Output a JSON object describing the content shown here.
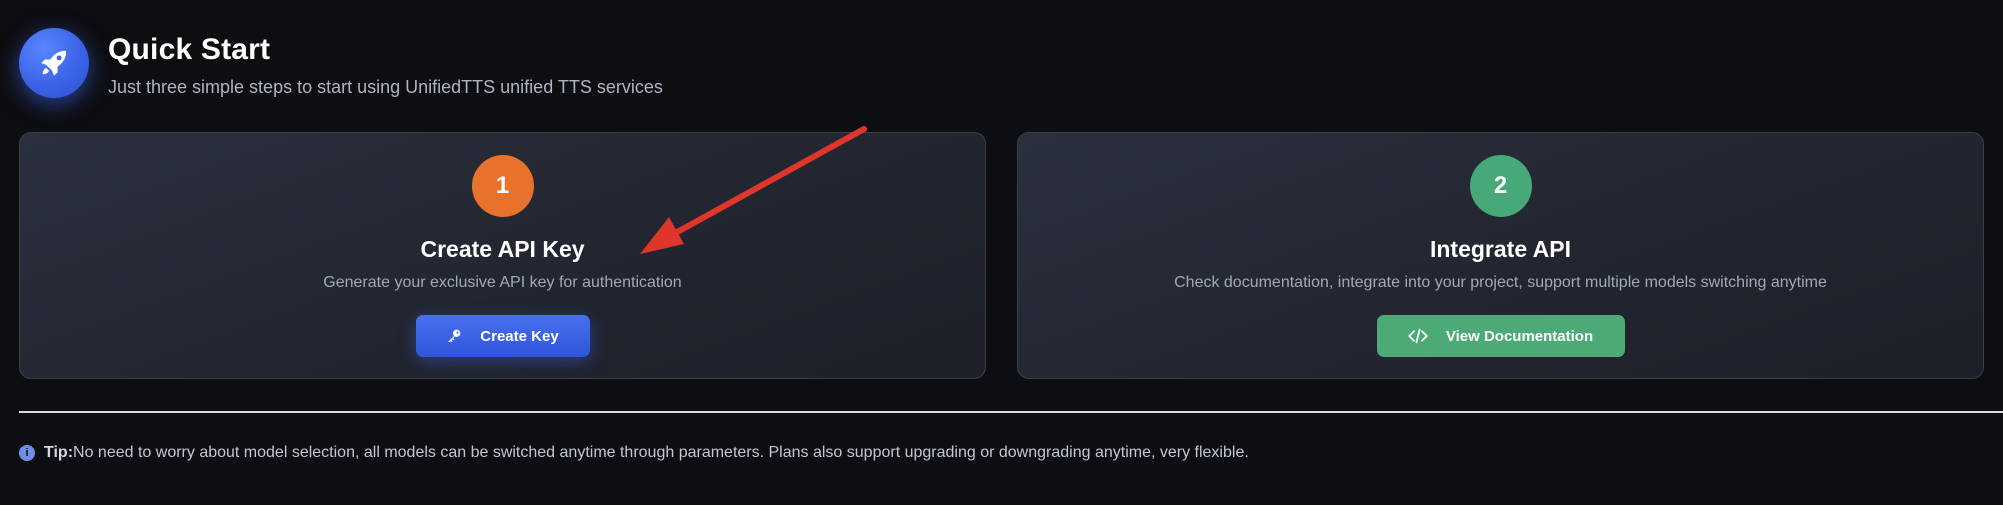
{
  "header": {
    "title": "Quick Start",
    "subtitle": "Just three simple steps to start using UnifiedTTS unified TTS services",
    "icon": "rocket-icon"
  },
  "steps": [
    {
      "number": "1",
      "title": "Create API Key",
      "description": "Generate your exclusive API key for authentication",
      "button_label": "Create Key",
      "button_icon": "key-icon",
      "accent": "#e8722c",
      "button_color": "#3a62e6"
    },
    {
      "number": "2",
      "title": "Integrate API",
      "description": "Check documentation, integrate into your project, support multiple models switching anytime",
      "button_label": "View Documentation",
      "button_icon": "code-icon",
      "accent": "#47a878",
      "button_color": "#4caa77"
    }
  ],
  "tip": {
    "label": "Tip:",
    "text": "No need to worry about model selection, all models can be switched anytime through parameters. Plans also support upgrading or downgrading anytime, very flexible.",
    "icon": "info-icon"
  },
  "annotation": {
    "icon": "red-arrow-icon",
    "color": "#e0352b"
  }
}
